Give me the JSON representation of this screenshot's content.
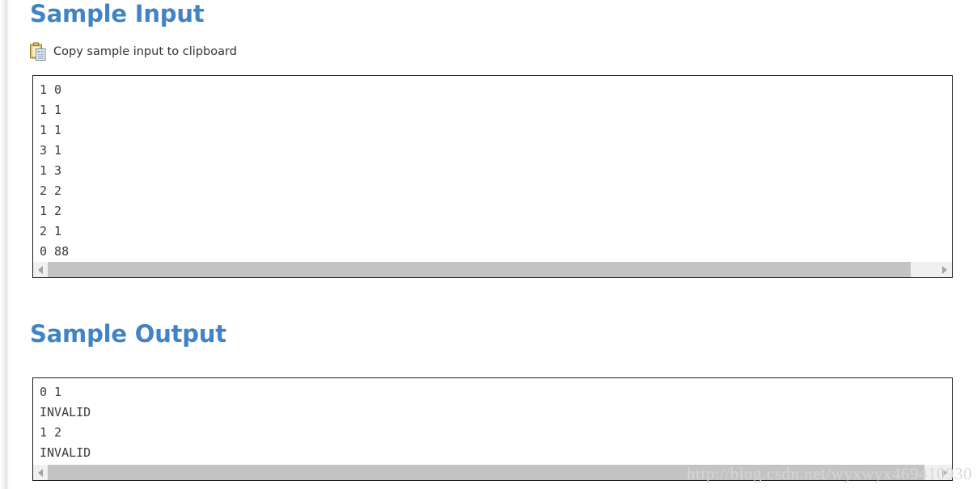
{
  "page": {
    "watermark": "http://blog.csdn.net/wyxwyx469410930",
    "accent_color": "#4183c4",
    "text_color": "#3b3b3b",
    "box_border_color": "#1c1c1c",
    "scrollbar_thumb_color": "#c3c3c3",
    "scrollbar_track_color": "#f0f0f0"
  },
  "sample_input": {
    "title": "Sample Input",
    "copy_link_label": "Copy sample input to clipboard",
    "copy_icon": "clipboard-icon",
    "lines": [
      "1 0",
      "1 1",
      "1 1",
      "3 1",
      "1 3",
      "2 2",
      "1 2",
      "2 1",
      "0 88"
    ],
    "text": "1 0\n1 1\n1 1\n3 1\n1 3\n2 2\n1 2\n2 1\n0 88",
    "scrollbar": {
      "left_arrow": "◀",
      "right_arrow": "▶"
    }
  },
  "sample_output": {
    "title": "Sample Output",
    "lines": [
      "0 1",
      "INVALID",
      "1 2",
      "INVALID"
    ],
    "text": "0 1\nINVALID\n1 2\nINVALID",
    "scrollbar": {
      "left_arrow": "◀",
      "right_arrow": "▶"
    }
  }
}
